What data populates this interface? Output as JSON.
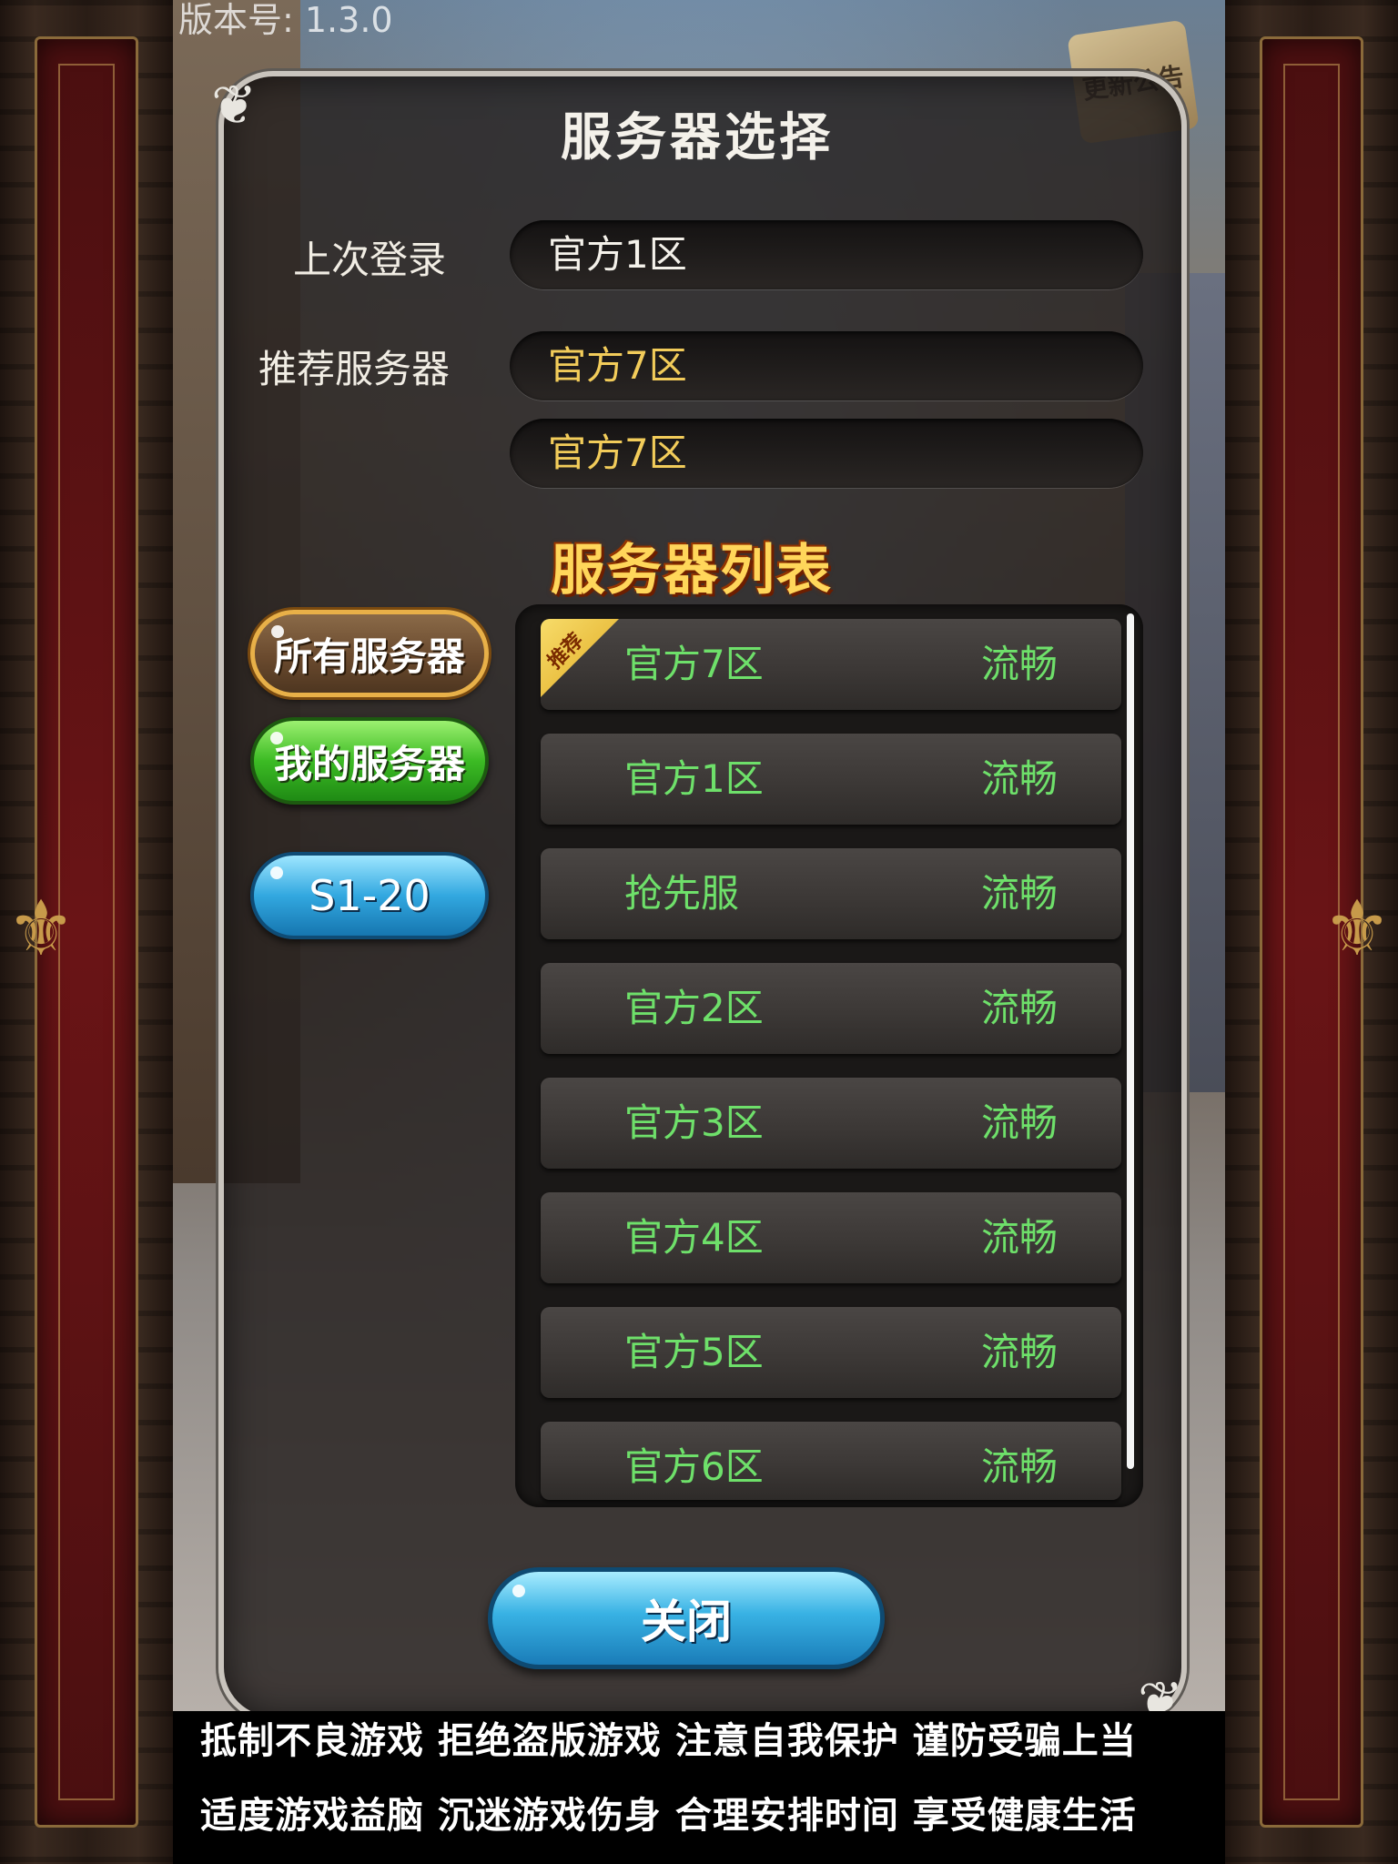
{
  "version": "版本号: 1.3.0",
  "news_button": "更新公告",
  "dialog": {
    "title": "服务器选择",
    "last_login_label": "上次登录",
    "last_login_server": "官方1区",
    "recommended_label": "推荐服务器",
    "recommended_servers": [
      "官方7区",
      "官方7区"
    ],
    "list_title": "服务器列表"
  },
  "tabs": {
    "all": "所有服务器",
    "mine": "我的服务器",
    "range": "S1-20"
  },
  "servers": [
    {
      "name": "官方7区",
      "status": "流畅",
      "badge": "推荐"
    },
    {
      "name": "官方1区",
      "status": "流畅"
    },
    {
      "name": "抢先服",
      "status": "流畅"
    },
    {
      "name": "官方2区",
      "status": "流畅"
    },
    {
      "name": "官方3区",
      "status": "流畅"
    },
    {
      "name": "官方4区",
      "status": "流畅"
    },
    {
      "name": "官方5区",
      "status": "流畅"
    },
    {
      "name": "官方6区",
      "status": "流畅"
    }
  ],
  "close_button": "关闭",
  "notice": {
    "line1": "抵制不良游戏 拒绝盗版游戏 注意自我保护 谨防受骗上当",
    "line2": "适度游戏益脑 沉迷游戏伤身 合理安排时间 享受健康生活"
  },
  "colors": {
    "server_text": "#6ee06a",
    "gold_text": "#f2cc5a",
    "tab_all": "#e8b048",
    "tab_mine": "#3cbb24",
    "tab_range": "#32a8e0"
  }
}
